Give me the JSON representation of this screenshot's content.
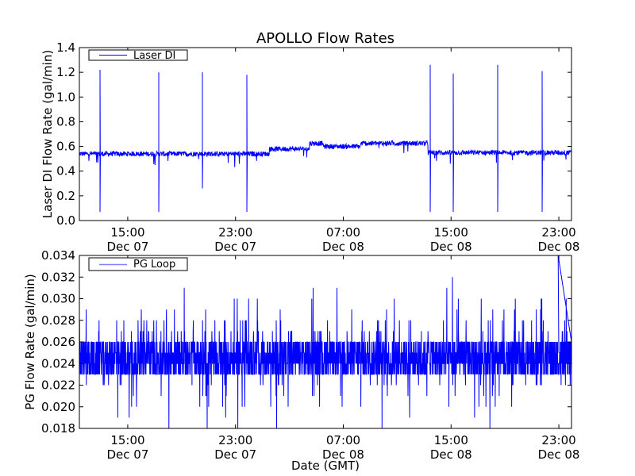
{
  "chart_data": [
    {
      "type": "line",
      "title": "APOLLO Flow Rates",
      "ylabel": "Laser DI Flow Rate (gal/min)",
      "ylim": [
        0.0,
        1.4
      ],
      "yticks": [
        "0.0",
        "0.2",
        "0.4",
        "0.6",
        "0.8",
        "1.0",
        "1.2",
        "1.4"
      ],
      "xlim_hours_from_dec07_0000": [
        11.41,
        47.94
      ],
      "xticks": [
        {
          "hour": 15,
          "time": "15:00",
          "date": "Dec 07"
        },
        {
          "hour": 23,
          "time": "23:00",
          "date": "Dec 07"
        },
        {
          "hour": 31,
          "time": "07:00",
          "date": "Dec 08"
        },
        {
          "hour": 39,
          "time": "15:00",
          "date": "Dec 08"
        },
        {
          "hour": 47,
          "time": "23:00",
          "date": "Dec 08"
        }
      ],
      "legend": {
        "label": "Laser DI",
        "placement": "top-left"
      },
      "color": "#0000ff",
      "baseline_segments": [
        {
          "from": 11.41,
          "to": 25.5,
          "level": 0.54
        },
        {
          "from": 25.5,
          "to": 28.5,
          "level": 0.58
        },
        {
          "from": 28.5,
          "to": 29.5,
          "level": 0.625
        },
        {
          "from": 29.5,
          "to": 32.3,
          "level": 0.6
        },
        {
          "from": 32.3,
          "to": 37.3,
          "level": 0.625
        },
        {
          "from": 37.3,
          "to": 47.94,
          "level": 0.55
        }
      ],
      "noise": 0.02,
      "spikes": [
        {
          "hour": 12.94,
          "high": 1.22,
          "low": 0.07
        },
        {
          "hour": 17.3,
          "high": 1.2,
          "low": 0.07
        },
        {
          "hour": 20.54,
          "high": 1.2,
          "low": 0.26
        },
        {
          "hour": 23.84,
          "high": 1.18,
          "low": 0.07
        },
        {
          "hour": 37.45,
          "high": 1.26,
          "low": 0.07
        },
        {
          "hour": 39.16,
          "high": 1.19,
          "low": 0.07
        },
        {
          "hour": 42.46,
          "high": 1.26,
          "low": 0.07
        },
        {
          "hour": 45.76,
          "high": 1.21,
          "low": 0.07
        }
      ]
    },
    {
      "type": "line",
      "ylabel": "PG Flow Rate (gal/min)",
      "xlabel": "Date (GMT)",
      "ylim": [
        0.018,
        0.034
      ],
      "yticks": [
        "0.018",
        "0.020",
        "0.022",
        "0.024",
        "0.026",
        "0.028",
        "0.030",
        "0.032",
        "0.034"
      ],
      "xlim_hours_from_dec07_0000": [
        11.41,
        47.94
      ],
      "xticks": [
        {
          "hour": 15,
          "time": "15:00",
          "date": "Dec 07"
        },
        {
          "hour": 23,
          "time": "23:00",
          "date": "Dec 07"
        },
        {
          "hour": 31,
          "time": "07:00",
          "date": "Dec 08"
        },
        {
          "hour": 39,
          "time": "15:00",
          "date": "Dec 08"
        },
        {
          "hour": 47,
          "time": "23:00",
          "date": "Dec 08"
        }
      ],
      "legend": {
        "label": "PG Loop",
        "placement": "top-left"
      },
      "color": "#0000ff",
      "band": [
        0.023,
        0.026
      ],
      "resolution": 0.001,
      "max_value": 0.034,
      "min_value": 0.018
    }
  ]
}
